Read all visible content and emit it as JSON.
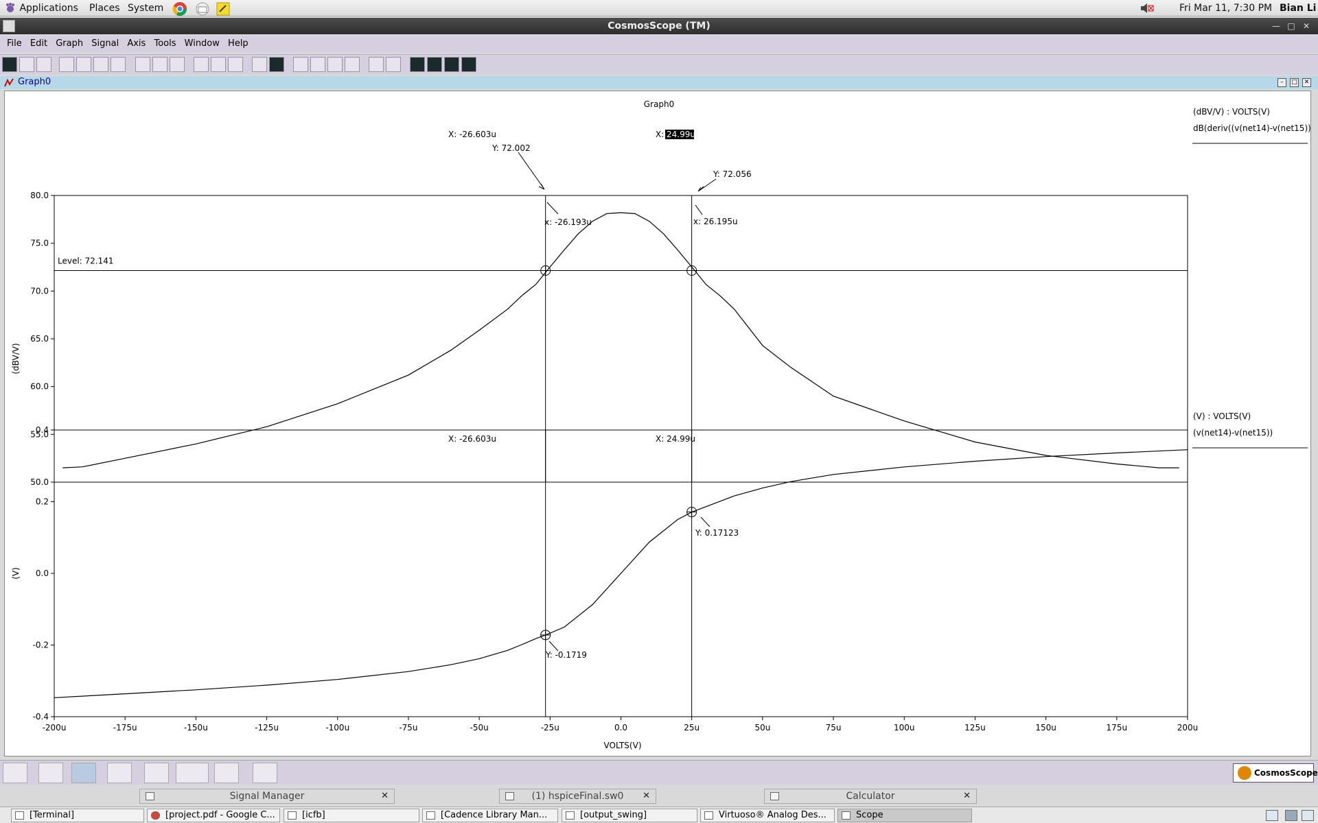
{
  "panel": {
    "applications": "Applications",
    "places": "Places",
    "system": "System",
    "datetime": "Fri Mar 11,  7:30 PM",
    "user": "Bian Li"
  },
  "window": {
    "title": "CosmosScope (TM)"
  },
  "menu": [
    "File",
    "Edit",
    "Graph",
    "Signal",
    "Axis",
    "Tools",
    "Window",
    "Help"
  ],
  "graph_window": {
    "title": "Graph0"
  },
  "chart_data": [
    {
      "type": "line",
      "title": "Graph0",
      "ylabel": "(dBV/V)",
      "xlabel": "VOLTS(V)",
      "ylim": [
        50,
        80
      ],
      "xlim": [
        -200,
        200
      ],
      "y_ticks": [
        "80.0",
        "75.0",
        "70.0",
        "65.0",
        "60.0",
        "55.0",
        "50.0"
      ],
      "legend_header": "(dBV/V) : VOLTS(V)",
      "legend_entry": "dB(deriv((v(net14)-v(net15))))",
      "level_label": "Level: 72.141",
      "level": 72.141,
      "cursor1": {
        "x_label": "X: -26.603u",
        "y_label": "Y: 72.002",
        "cross_label": "x: -26.193u",
        "x": -26.603
      },
      "cursor2": {
        "x_prefix": "X:",
        "x_value": "24.99u",
        "y_label": "Y: 72.056",
        "cross_label": "x: 26.195u",
        "x": 24.99
      },
      "series": [
        {
          "x": [
            -197,
            -190,
            -175,
            -150,
            -125,
            -100,
            -75,
            -60,
            -50,
            -40,
            -35,
            -30,
            -26.2,
            -20,
            -15,
            -10,
            -5,
            0,
            5,
            10,
            15,
            20,
            26.2,
            30,
            35,
            40,
            50,
            60,
            75,
            100,
            125,
            150,
            175,
            190,
            197
          ],
          "values": [
            51.5,
            51.6,
            52.5,
            54.0,
            55.8,
            58.2,
            61.2,
            63.8,
            65.9,
            68.1,
            69.5,
            70.7,
            72.1,
            74.3,
            76.0,
            77.3,
            78.1,
            78.2,
            78.1,
            77.3,
            76.0,
            74.3,
            72.1,
            70.7,
            69.5,
            68.1,
            64.3,
            62.0,
            59.0,
            56.4,
            54.2,
            52.8,
            51.9,
            51.5,
            51.5
          ]
        }
      ]
    },
    {
      "type": "line",
      "ylabel": "(V)",
      "xlabel": "VOLTS(V)",
      "ylim": [
        -0.4,
        0.4
      ],
      "xlim": [
        -200,
        200
      ],
      "y_ticks": [
        "0.4",
        "0.2",
        "0.0",
        "-0.2",
        "-0.4"
      ],
      "x_ticks": [
        "-200u",
        "-175u",
        "-150u",
        "-125u",
        "-100u",
        "-75u",
        "-50u",
        "-25u",
        "0.0",
        "25u",
        "50u",
        "75u",
        "100u",
        "125u",
        "150u",
        "175u",
        "200u"
      ],
      "legend_header": "(V) : VOLTS(V)",
      "legend_entry": "(v(net14)-v(net15))",
      "cursor1": {
        "x_label": "X: -26.603u",
        "y_label": "Y: -0.1719",
        "x": -26.603,
        "y": -0.1719
      },
      "cursor2": {
        "x_label": "X: 24.99u",
        "y_label": "Y: 0.17123",
        "x": 24.99,
        "y": 0.17123
      },
      "series": [
        {
          "x": [
            -200,
            -175,
            -150,
            -125,
            -100,
            -75,
            -60,
            -50,
            -40,
            -35,
            -30,
            -26.6,
            -20,
            -10,
            0,
            10,
            20,
            25,
            30,
            40,
            50,
            60,
            75,
            100,
            125,
            150,
            175,
            200
          ],
          "values": [
            -0.347,
            -0.336,
            -0.325,
            -0.312,
            -0.296,
            -0.274,
            -0.255,
            -0.238,
            -0.215,
            -0.199,
            -0.182,
            -0.172,
            -0.15,
            -0.087,
            0.0,
            0.087,
            0.15,
            0.171,
            0.186,
            0.216,
            0.238,
            0.256,
            0.276,
            0.297,
            0.313,
            0.326,
            0.336,
            0.345
          ]
        }
      ]
    }
  ],
  "bottom_badge": "CosmosScope",
  "floating_tabs": [
    "Signal Manager",
    "(1) hspiceFinal.sw0",
    "Calculator"
  ],
  "taskbar": [
    "[Terminal]",
    "[project.pdf - Google C...",
    "[icfb]",
    "[Cadence Library Man...",
    "[output_swing]",
    "Virtuoso® Analog Des...",
    "Scope"
  ],
  "colors": {
    "menubar": "#d6cfe0",
    "graph_strip": "#b7d8e8",
    "titlebar": "#3a3a3a"
  }
}
